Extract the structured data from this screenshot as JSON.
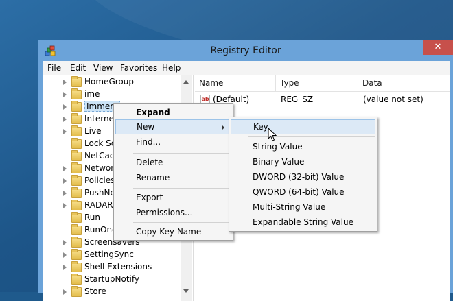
{
  "window": {
    "title": "Registry Editor",
    "close_glyph": "✕",
    "app_icon": "registry-editor-icon"
  },
  "menubar": {
    "items": [
      "File",
      "Edit",
      "View",
      "Favorites",
      "Help"
    ]
  },
  "tree": {
    "items": [
      {
        "label": "HomeGroup",
        "expandable": true
      },
      {
        "label": "ime",
        "expandable": true
      },
      {
        "label": "Immers",
        "expandable": true,
        "selected": true
      },
      {
        "label": "Internet",
        "expandable": true
      },
      {
        "label": "Live",
        "expandable": true
      },
      {
        "label": "Lock Sc",
        "expandable": false
      },
      {
        "label": "NetCach",
        "expandable": false
      },
      {
        "label": "Networ",
        "expandable": true
      },
      {
        "label": "Policies",
        "expandable": true
      },
      {
        "label": "PushNo",
        "expandable": true
      },
      {
        "label": "RADAR",
        "expandable": true
      },
      {
        "label": "Run",
        "expandable": false
      },
      {
        "label": "RunOnc",
        "expandable": false
      },
      {
        "label": "Screensavers",
        "expandable": true
      },
      {
        "label": "SettingSync",
        "expandable": true
      },
      {
        "label": "Shell Extensions",
        "expandable": true
      },
      {
        "label": "StartupNotify",
        "expandable": false
      },
      {
        "label": "Store",
        "expandable": true
      }
    ]
  },
  "list": {
    "headers": {
      "name": "Name",
      "type": "Type",
      "data": "Data"
    },
    "rows": [
      {
        "name": "(Default)",
        "type": "REG_SZ",
        "data": "(value not set)",
        "icon": "string-value-icon",
        "icon_text": "ab"
      }
    ]
  },
  "context_menu": {
    "items": [
      {
        "label": "Expand",
        "bold": true
      },
      {
        "label": "New",
        "has_submenu": true,
        "highlighted": true
      },
      {
        "label": "Find..."
      },
      {
        "label": "Delete"
      },
      {
        "label": "Rename"
      },
      {
        "label": "Export"
      },
      {
        "label": "Permissions..."
      },
      {
        "label": "Copy Key Name"
      }
    ]
  },
  "submenu": {
    "items": [
      {
        "label": "Key",
        "highlighted": true
      },
      {
        "label": "String Value"
      },
      {
        "label": "Binary Value"
      },
      {
        "label": "DWORD (32-bit) Value"
      },
      {
        "label": "QWORD (64-bit) Value"
      },
      {
        "label": "Multi-String Value"
      },
      {
        "label": "Expandable String Value"
      }
    ]
  },
  "colors": {
    "title_bar": "#6ba3d9",
    "close_button": "#c7504b",
    "menu_highlight": "#dce9f6",
    "folder": "#e3bd4c"
  }
}
